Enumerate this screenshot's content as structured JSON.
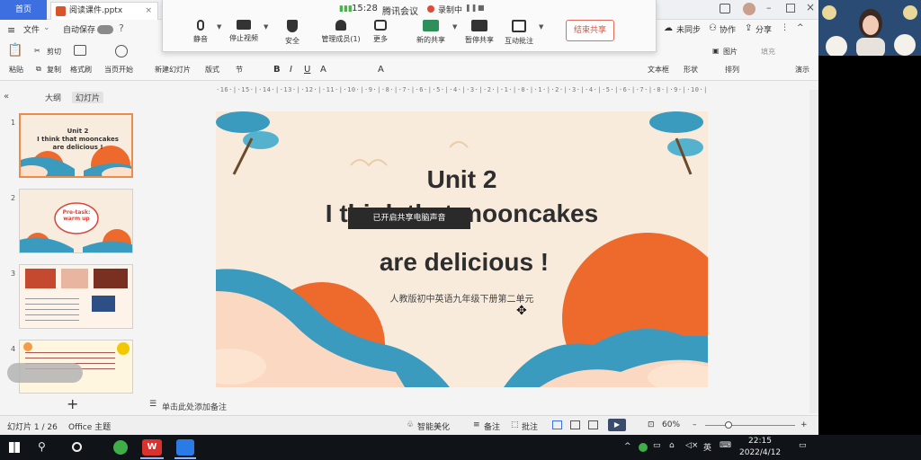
{
  "titlebar": {
    "home_tab": "首页",
    "doc_tab": "阅读课件.pptx"
  },
  "menubar": {
    "file": "文件",
    "autosave": "自动保存",
    "sync": "未同步",
    "collab": "协作",
    "share": "分享"
  },
  "toolbar": {
    "cut": "剪切",
    "paste": "粘贴",
    "copy": "复制",
    "format_painter": "格式刷",
    "from_start": "当页开始",
    "new_slide": "新建幻灯片",
    "layout": "版式",
    "section": "节",
    "textbox": "文本框",
    "shape": "形状",
    "arrange": "排列",
    "picture": "图片",
    "fill": "填充",
    "play": "演示"
  },
  "meeting": {
    "time": "15:28",
    "app_name": "腾讯会议",
    "recording": "录制中",
    "mute": "静音",
    "stop_video": "停止视频",
    "security": "安全",
    "manage_members": "管理成员(1)",
    "more": "更多",
    "new_share": "新的共享",
    "pause_share": "暂停共享",
    "annotate": "互动批注",
    "end_share": "结束共享"
  },
  "ruler": "·16·|·15·|·14·|·13·|·12·|·11·|·10·|·9·|·8·|·7·|·6·|·5·|·4·|·3·|·2·|·1·|·0·|·1·|·2·|·3·|·4·|·5·|·6·|·7·|·8·|·9·|·10·|·11·|·12·|·13·|·14·|·15·|·16·",
  "panel": {
    "tab_outline": "大纲",
    "tab_slides": "幻灯片",
    "add": "+"
  },
  "thumbnails": [
    {
      "num": "1",
      "line1": "Unit 2",
      "line2": "I think that mooncakes",
      "line3": "are delicious !"
    },
    {
      "num": "2",
      "label": "Pre-task: warm up"
    },
    {
      "num": "3"
    },
    {
      "num": "4"
    }
  ],
  "slide": {
    "title_line1": "Unit 2",
    "title_line2": "I think that mooncakes",
    "title_line3": "are delicious !",
    "subtitle": "人教版初中英语九年级下册第二单元",
    "toast": "已开启共享电脑声音"
  },
  "notes": {
    "placeholder": "单击此处添加备注"
  },
  "statusbar": {
    "slide_count": "幻灯片 1 / 26",
    "theme": "Office 主题",
    "smart_beautify": "智能美化",
    "notes": "备注",
    "comments": "批注",
    "zoom": "60%"
  },
  "taskbar": {
    "ime": "英",
    "time": "22:15",
    "date": "2022/4/12"
  },
  "colors": {
    "accent_blue": "#3d6fe0",
    "end_share_red": "#e0503c",
    "slide_orange": "#ee6a2c",
    "slide_teal": "#3a9bbf"
  }
}
